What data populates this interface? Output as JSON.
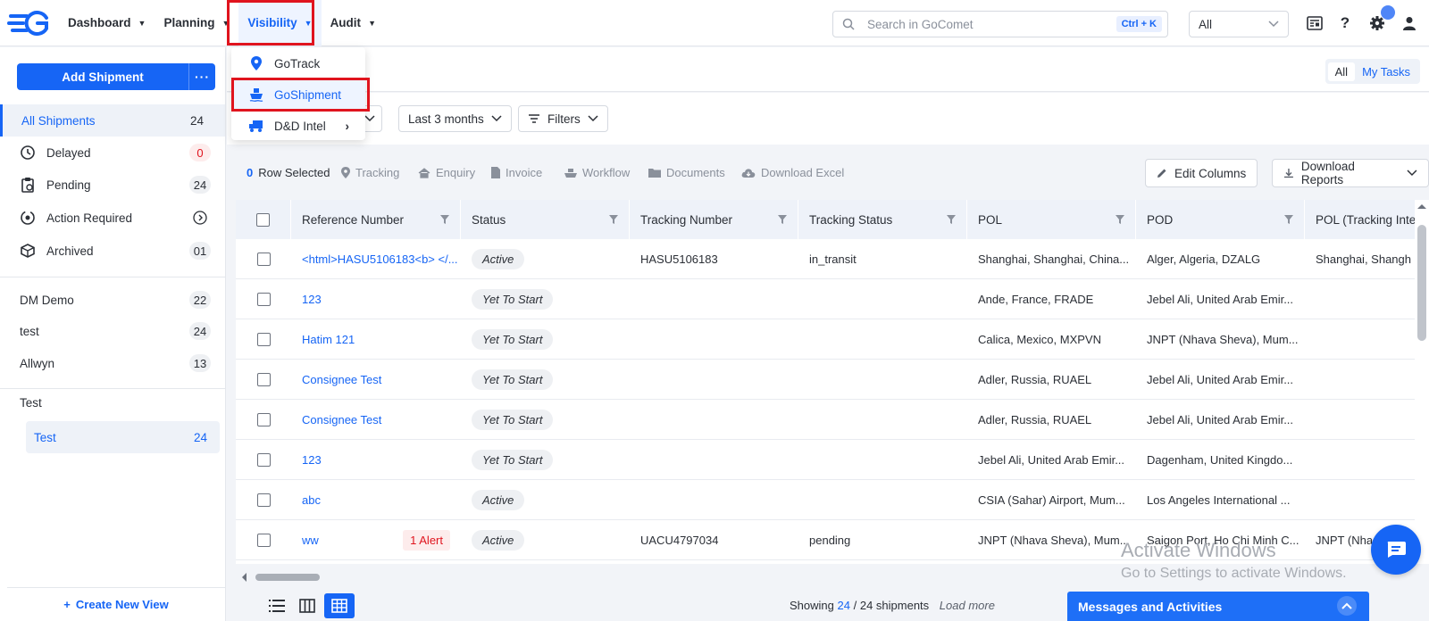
{
  "nav": {
    "items": [
      {
        "label": "Dashboard"
      },
      {
        "label": "Planning"
      },
      {
        "label": "Visibility"
      },
      {
        "label": "Audit"
      }
    ],
    "search_placeholder": "Search in GoComet",
    "search_shortcut": "Ctrl + K",
    "scope_select": "All",
    "help": "?"
  },
  "visibility_menu": {
    "items": [
      {
        "label": "GoTrack"
      },
      {
        "label": "GoShipment"
      },
      {
        "label": "D&D Intel"
      }
    ]
  },
  "sidebar": {
    "add_button": "Add Shipment",
    "add_more": "···",
    "items": [
      {
        "label": "All Shipments",
        "count": "24"
      },
      {
        "label": "Delayed",
        "count": "0"
      },
      {
        "label": "Pending",
        "count": "24"
      },
      {
        "label": "Action Required",
        "count": ""
      },
      {
        "label": "Archived",
        "count": "01"
      }
    ],
    "views": [
      {
        "label": "DM Demo",
        "count": "22"
      },
      {
        "label": "test",
        "count": "24"
      },
      {
        "label": "Allwyn",
        "count": "13"
      }
    ],
    "group_title": "Test",
    "group_item": {
      "label": "Test",
      "count": "24"
    },
    "create_view": "Create New View"
  },
  "header": {
    "toggle_all": "All",
    "toggle_tasks": "My Tasks"
  },
  "filters": {
    "date_range": "Last 3 months",
    "filters": "Filters"
  },
  "actions": {
    "selected_count": "0",
    "selected_label": "Row Selected",
    "tracking": "Tracking",
    "enquiry": "Enquiry",
    "invoice": "Invoice",
    "workflow": "Workflow",
    "documents": "Documents",
    "download_excel": "Download Excel",
    "edit_columns": "Edit Columns",
    "download_reports": "Download Reports"
  },
  "table": {
    "columns": [
      "Reference Number",
      "Status",
      "Tracking Number",
      "Tracking Status",
      "POL",
      "POD",
      "POL (Tracking Inte"
    ],
    "rows": [
      {
        "ref": "<html>HASU5106183<b> </...",
        "alert": "",
        "status": "Active",
        "tracking": "HASU5106183",
        "tstatus": "in_transit",
        "pol": "Shanghai, Shanghai, China...",
        "pod": "Alger, Algeria, DZALG",
        "pol_ti": "Shanghai, Shangh"
      },
      {
        "ref": "123",
        "alert": "",
        "status": "Yet To Start",
        "tracking": "",
        "tstatus": "",
        "pol": "Ande, France, FRADE",
        "pod": "Jebel Ali, United Arab Emir...",
        "pol_ti": ""
      },
      {
        "ref": "Hatim 121",
        "alert": "",
        "status": "Yet To Start",
        "tracking": "",
        "tstatus": "",
        "pol": "Calica, Mexico, MXPVN",
        "pod": "JNPT (Nhava Sheva), Mum...",
        "pol_ti": ""
      },
      {
        "ref": "Consignee Test",
        "alert": "",
        "status": "Yet To Start",
        "tracking": "",
        "tstatus": "",
        "pol": "Adler, Russia, RUAEL",
        "pod": "Jebel Ali, United Arab Emir...",
        "pol_ti": ""
      },
      {
        "ref": "Consignee Test",
        "alert": "",
        "status": "Yet To Start",
        "tracking": "",
        "tstatus": "",
        "pol": "Adler, Russia, RUAEL",
        "pod": "Jebel Ali, United Arab Emir...",
        "pol_ti": ""
      },
      {
        "ref": "123",
        "alert": "",
        "status": "Yet To Start",
        "tracking": "",
        "tstatus": "",
        "pol": "Jebel Ali, United Arab Emir...",
        "pod": "Dagenham, United Kingdo...",
        "pol_ti": ""
      },
      {
        "ref": "abc",
        "alert": "",
        "status": "Active",
        "tracking": "",
        "tstatus": "",
        "pol": "CSIA (Sahar) Airport, Mum...",
        "pod": "Los Angeles International ...",
        "pol_ti": ""
      },
      {
        "ref": "ww",
        "alert": "1 Alert",
        "status": "Active",
        "tracking": "UACU4797034",
        "tstatus": "pending",
        "pol": "JNPT (Nhava Sheva), Mum...",
        "pod": "Saigon Port, Ho Chi Minh C...",
        "pol_ti": "JNPT (Nha"
      }
    ]
  },
  "footer": {
    "showing": "Showing",
    "shown": "24",
    "sep": "/",
    "total": "24 shipments",
    "load_more": "Load more",
    "messages": "Messages and Activities"
  },
  "watermark": {
    "line1": "Activate Windows",
    "line2": "Go to Settings to activate Windows."
  },
  "colors": {
    "primary": "#1665f5",
    "highlight": "#e0141e",
    "alert_bg": "#fdecec"
  }
}
